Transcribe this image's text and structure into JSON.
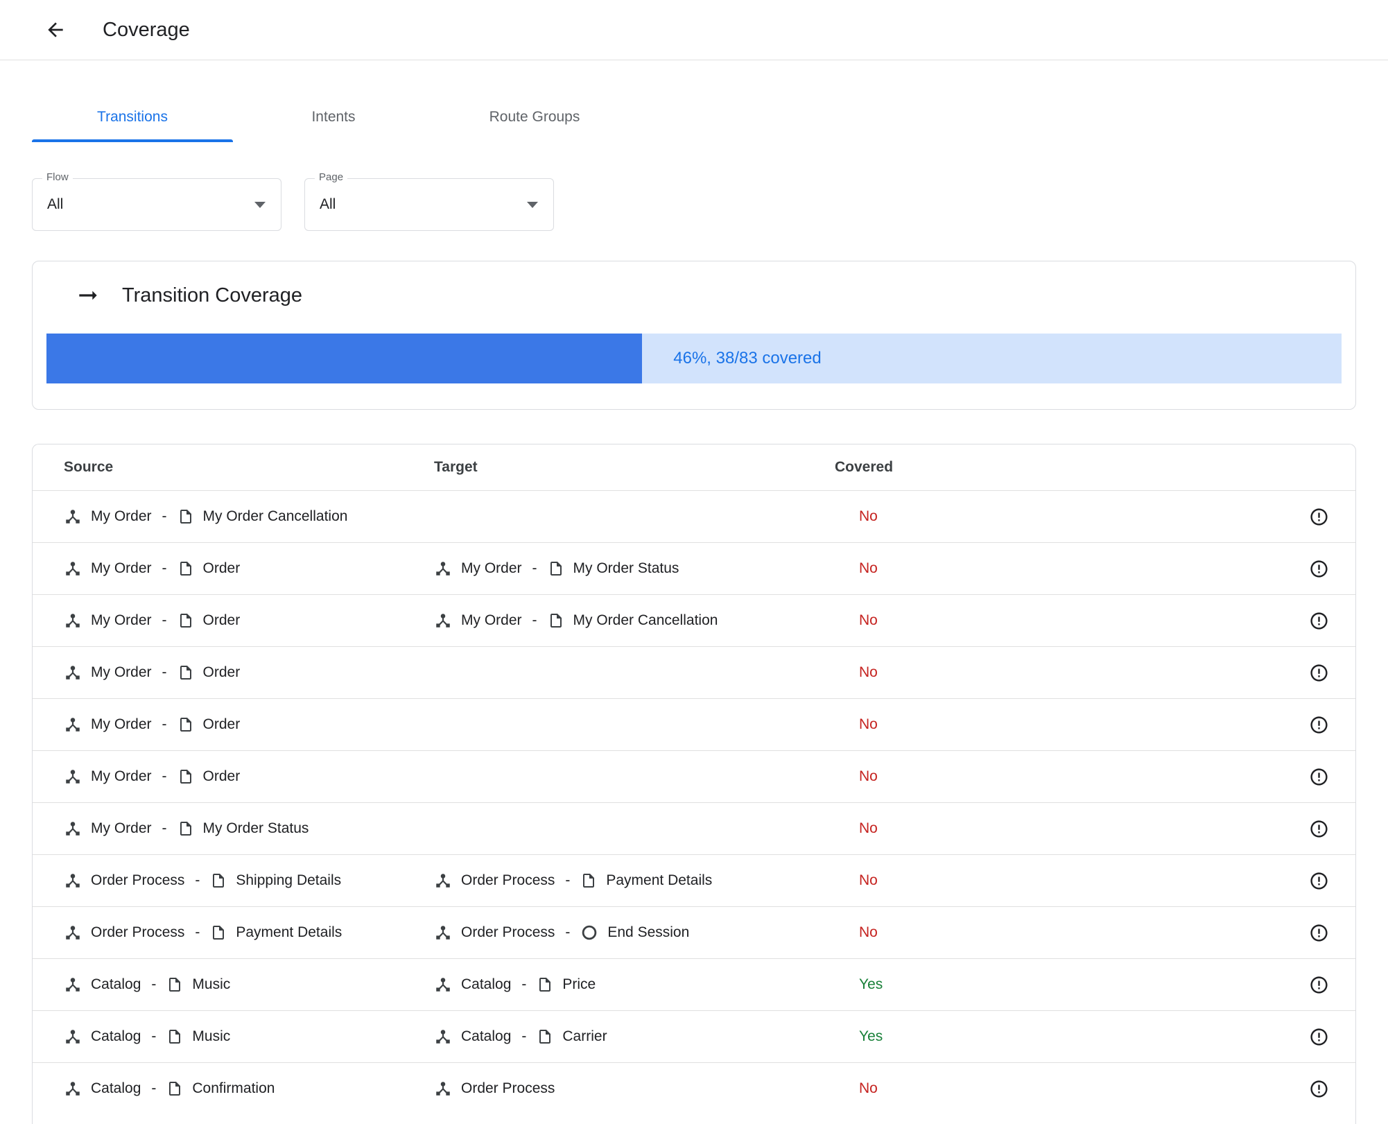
{
  "header": {
    "title": "Coverage",
    "back_icon": "arrow-back-icon"
  },
  "tabs": [
    {
      "label": "Transitions",
      "active": true
    },
    {
      "label": "Intents",
      "active": false
    },
    {
      "label": "Route Groups",
      "active": false
    }
  ],
  "filters": {
    "flow": {
      "label": "Flow",
      "value": "All"
    },
    "page": {
      "label": "Page",
      "value": "All"
    }
  },
  "coverage_card": {
    "icon": "right-arrow-icon",
    "title": "Transition Coverage",
    "progress_percent": 46,
    "covered_count": 38,
    "total_count": 83,
    "progress_label": "46%, 38/83 covered"
  },
  "table": {
    "columns": [
      "Source",
      "Target",
      "Covered"
    ],
    "rows": [
      {
        "source": {
          "flow": "My Order",
          "page": "My Order Cancellation",
          "page_icon": "page"
        },
        "target": null,
        "covered": "No"
      },
      {
        "source": {
          "flow": "My Order",
          "page": "Order",
          "page_icon": "page"
        },
        "target": {
          "flow": "My Order",
          "page": "My Order Status",
          "page_icon": "page"
        },
        "covered": "No"
      },
      {
        "source": {
          "flow": "My Order",
          "page": "Order",
          "page_icon": "page"
        },
        "target": {
          "flow": "My Order",
          "page": "My Order Cancellation",
          "page_icon": "page"
        },
        "covered": "No"
      },
      {
        "source": {
          "flow": "My Order",
          "page": "Order",
          "page_icon": "page"
        },
        "target": null,
        "covered": "No"
      },
      {
        "source": {
          "flow": "My Order",
          "page": "Order",
          "page_icon": "page"
        },
        "target": null,
        "covered": "No"
      },
      {
        "source": {
          "flow": "My Order",
          "page": "Order",
          "page_icon": "page"
        },
        "target": null,
        "covered": "No"
      },
      {
        "source": {
          "flow": "My Order",
          "page": "My Order Status",
          "page_icon": "page"
        },
        "target": null,
        "covered": "No"
      },
      {
        "source": {
          "flow": "Order Process",
          "page": "Shipping Details",
          "page_icon": "page"
        },
        "target": {
          "flow": "Order Process",
          "page": "Payment Details",
          "page_icon": "page"
        },
        "covered": "No"
      },
      {
        "source": {
          "flow": "Order Process",
          "page": "Payment Details",
          "page_icon": "page"
        },
        "target": {
          "flow": "Order Process",
          "page": "End Session",
          "page_icon": "end-session"
        },
        "covered": "No"
      },
      {
        "source": {
          "flow": "Catalog",
          "page": "Music",
          "page_icon": "page"
        },
        "target": {
          "flow": "Catalog",
          "page": "Price",
          "page_icon": "page"
        },
        "covered": "Yes"
      },
      {
        "source": {
          "flow": "Catalog",
          "page": "Music",
          "page_icon": "page"
        },
        "target": {
          "flow": "Catalog",
          "page": "Carrier",
          "page_icon": "page"
        },
        "covered": "Yes"
      },
      {
        "source": {
          "flow": "Catalog",
          "page": "Confirmation",
          "page_icon": "page"
        },
        "target": {
          "flow": "Order Process",
          "page": null,
          "page_icon": null
        },
        "covered": "No"
      }
    ]
  },
  "colors": {
    "accent_blue": "#1a73e8",
    "progress_fill": "#3b78e7",
    "progress_track": "#d2e3fc",
    "covered_no": "#c5221f",
    "covered_yes": "#188038",
    "border": "#dadce0",
    "text_primary": "#202124",
    "text_secondary": "#5f6368"
  }
}
